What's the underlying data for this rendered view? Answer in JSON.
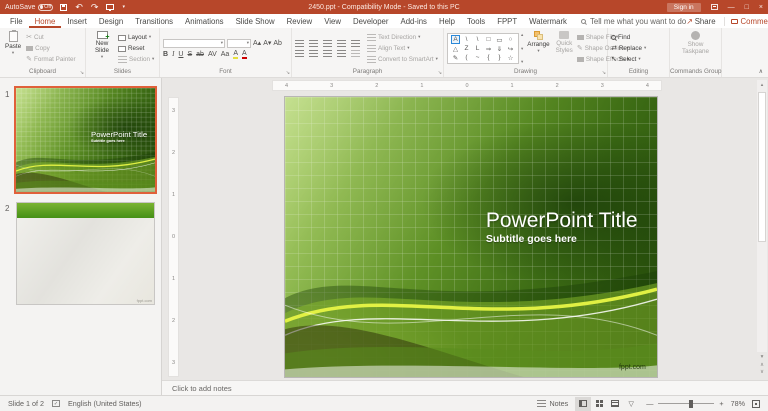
{
  "colors": {
    "titlebar": "#b7472a",
    "accent": "#b7472a",
    "selection": "#e0603a",
    "slide_light": "#a6cf55",
    "slide_dark": "#234709"
  },
  "titlebar": {
    "autosave": "AutoSave",
    "autosave_state": "Off",
    "doc_title": "2450.ppt  -  Compatibility Mode  -  Saved to this PC",
    "sign_in": "Sign in"
  },
  "tabs": {
    "items": [
      "File",
      "Home",
      "Insert",
      "Design",
      "Transitions",
      "Animations",
      "Slide Show",
      "Review",
      "View",
      "Developer",
      "Add-ins",
      "Help",
      "Tools",
      "FPPT",
      "Watermark"
    ],
    "search": "Tell me what you want to do",
    "share": "Share",
    "comments": "Comments"
  },
  "ribbon": {
    "clipboard": {
      "group": "Clipboard",
      "paste": "Paste",
      "cut": "Cut",
      "copy": "Copy",
      "format_painter": "Format Painter"
    },
    "slides": {
      "group": "Slides",
      "new_slide": "New Slide",
      "layout": "Layout",
      "reset": "Reset",
      "section": "Section"
    },
    "font": {
      "group": "Font",
      "bold": "B",
      "italic": "I",
      "underline": "U",
      "strike": "S",
      "abc": "ab",
      "grow": "A▴",
      "shrink": "A▾",
      "clear": "Ab",
      "spacing": "AV",
      "case": "Aa",
      "color": "A",
      "pen": "A"
    },
    "paragraph": {
      "group": "Paragraph",
      "text_direction": "Text Direction",
      "align_text": "Align Text",
      "smartart": "Convert to SmartArt"
    },
    "drawing": {
      "group": "Drawing",
      "arrange": "Arrange",
      "quick_styles": "Quick Styles",
      "shape_fill": "Shape Fill",
      "shape_outline": "Shape Outline",
      "shape_effects": "Shape Effects",
      "shapes": [
        "A",
        "\\",
        "\\",
        "□",
        "▭",
        "○",
        "△",
        "Z",
        "L",
        "⇒",
        "⇓",
        "↪",
        "✎",
        "(",
        "~",
        "{",
        "}",
        "☆"
      ]
    },
    "editing": {
      "group": "Editing",
      "find": "Find",
      "replace": "Replace",
      "select": "Select"
    },
    "commands": {
      "group": "Commands Group",
      "show_taskpane": "Show Taskpane"
    }
  },
  "glyphs": {
    "dropdown": "▾",
    "undo": "↶",
    "redo": "↷",
    "cut": "✂",
    "replace": "⇄",
    "select": "↖",
    "share": "↗",
    "close": "×",
    "minimize": "—",
    "restore": "□",
    "scroll_up": "▴",
    "scroll_down": "▾",
    "prev": "∧",
    "next": "∨",
    "slideshow": "▽",
    "check": "✓",
    "minus": "—",
    "plus": "+",
    "collapse": "∧",
    "launcher": "↘",
    "pencil": "✎",
    "more": "▾"
  },
  "ruler": {
    "h": [
      "4",
      "3",
      "2",
      "1",
      "0",
      "1",
      "2",
      "3",
      "4"
    ],
    "v": [
      "3",
      "2",
      "1",
      "0",
      "1",
      "2",
      "3"
    ]
  },
  "slide": {
    "title": "PowerPoint Title",
    "subtitle": "Subtitle goes here",
    "credit": "fppt.com"
  },
  "thumbnails": {
    "one": "1",
    "two": "2"
  },
  "notes": {
    "placeholder": "Click to add notes"
  },
  "status": {
    "slide": "Slide 1 of 2",
    "language": "English (United States)",
    "notes": "Notes",
    "zoom": "78%"
  }
}
